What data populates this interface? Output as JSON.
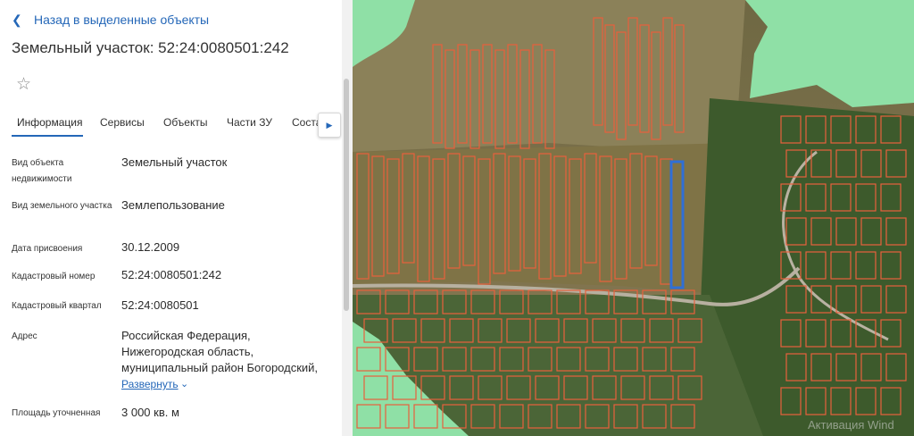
{
  "header": {
    "back_label": "Назад в выделенные объекты",
    "back_icon": "chevron-left-icon",
    "title": "Земельный участок: 52:24:0080501:242",
    "favorite_icon": "star-icon"
  },
  "tabs": [
    {
      "label": "Информация",
      "active": true
    },
    {
      "label": "Сервисы",
      "active": false
    },
    {
      "label": "Объекты",
      "active": false
    },
    {
      "label": "Части ЗУ",
      "active": false
    },
    {
      "label": "Соста",
      "active": false
    }
  ],
  "tabs_next_icon": "chevron-right-icon",
  "details": {
    "object_type": {
      "label": "Вид объекта недвижимости",
      "value": "Земельный участок"
    },
    "land_type": {
      "label": "Вид земельного участка",
      "value": "Землепользование"
    },
    "date": {
      "label": "Дата присвоения",
      "value": "30.12.2009"
    },
    "cadastral_number": {
      "label": "Кадастровый номер",
      "value": "52:24:0080501:242"
    },
    "cadastral_quarter": {
      "label": "Кадастровый квартал",
      "value": "52:24:0080501"
    },
    "address": {
      "label": "Адрес",
      "lines": [
        "Российская Федерация,",
        "Нижегородская область,",
        "муниципальный район Богородский,"
      ],
      "expand_label": "Развернуть",
      "expand_icon": "chevron-down-icon"
    },
    "area": {
      "label": "Площадь уточненная",
      "value": "3 000 кв. м"
    }
  },
  "map": {
    "selected_parcel_color": "#2f6fd6",
    "parcel_outline_color": "#e8603c",
    "zone_fill_color": "#8fe0a6",
    "watermark": "Активация Wind"
  }
}
